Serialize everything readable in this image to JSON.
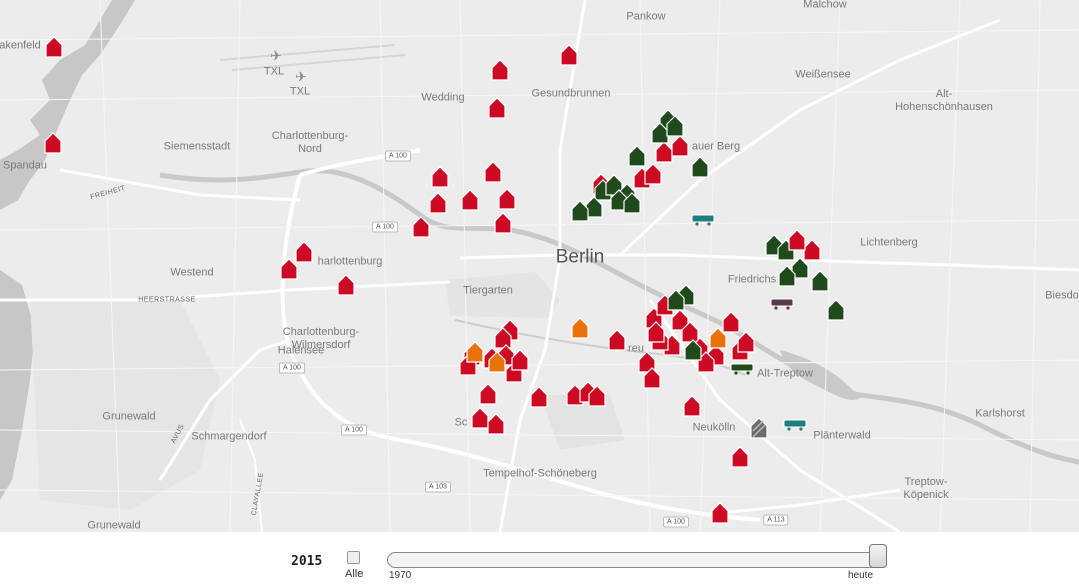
{
  "colors": {
    "red": "#cc0a24",
    "green": "#1e4a1c",
    "orange": "#e8720c",
    "gray": "#6c6c6c",
    "teal": "#1f7d7c",
    "purple": "#5a3a4e"
  },
  "places": [
    {
      "name": "Pankow"
    },
    {
      "name": "Malchow"
    },
    {
      "name": "Weißensee"
    },
    {
      "name": "Alt-\nHohenschönhausen"
    },
    {
      "name": "Wedding"
    },
    {
      "name": "Gesundbrunnen"
    },
    {
      "name": "TXL"
    },
    {
      "name": "TXL"
    },
    {
      "name": "akenfeld"
    },
    {
      "name": "Spandau"
    },
    {
      "name": "Siemensstadt"
    },
    {
      "name": "Charlottenburg-\nNord"
    },
    {
      "name": "auer Berg"
    },
    {
      "name": "Lichtenberg"
    },
    {
      "name": "Berlin"
    },
    {
      "name": "harlottenburg"
    },
    {
      "name": "Westend"
    },
    {
      "name": "Friedrichs"
    },
    {
      "name": "Biesdo"
    },
    {
      "name": "Tiergarten"
    },
    {
      "name": "Charlottenburg-\nWilmersdorf"
    },
    {
      "name": "Halensee"
    },
    {
      "name": "reu"
    },
    {
      "name": "Alt-Treptow"
    },
    {
      "name": "Karlshorst"
    },
    {
      "name": "Grunewald"
    },
    {
      "name": "Sc"
    },
    {
      "name": "Neukölln"
    },
    {
      "name": "Plänterwald"
    },
    {
      "name": "Schmargendorf"
    },
    {
      "name": "Tempelhof-Schöneberg"
    },
    {
      "name": "Treptow-\nKöpenick"
    },
    {
      "name": "Grunewald"
    }
  ],
  "roads": [
    {
      "name": "FREIHEIT"
    },
    {
      "name": "HEERSTRASSE"
    },
    {
      "name": "AVUS"
    },
    {
      "name": "CLAYALLEE"
    }
  ],
  "shields": [
    {
      "name": "A 100"
    },
    {
      "name": "A 100"
    },
    {
      "name": "A 100"
    },
    {
      "name": "A 100"
    },
    {
      "name": "A 103"
    },
    {
      "name": "A 100"
    },
    {
      "name": "A 113"
    }
  ],
  "controls": {
    "year": "2015",
    "alle_label": "Alle",
    "alle_checked": false,
    "min_label": "1970",
    "max_label": "heute",
    "slider_fraction": 1.0
  }
}
